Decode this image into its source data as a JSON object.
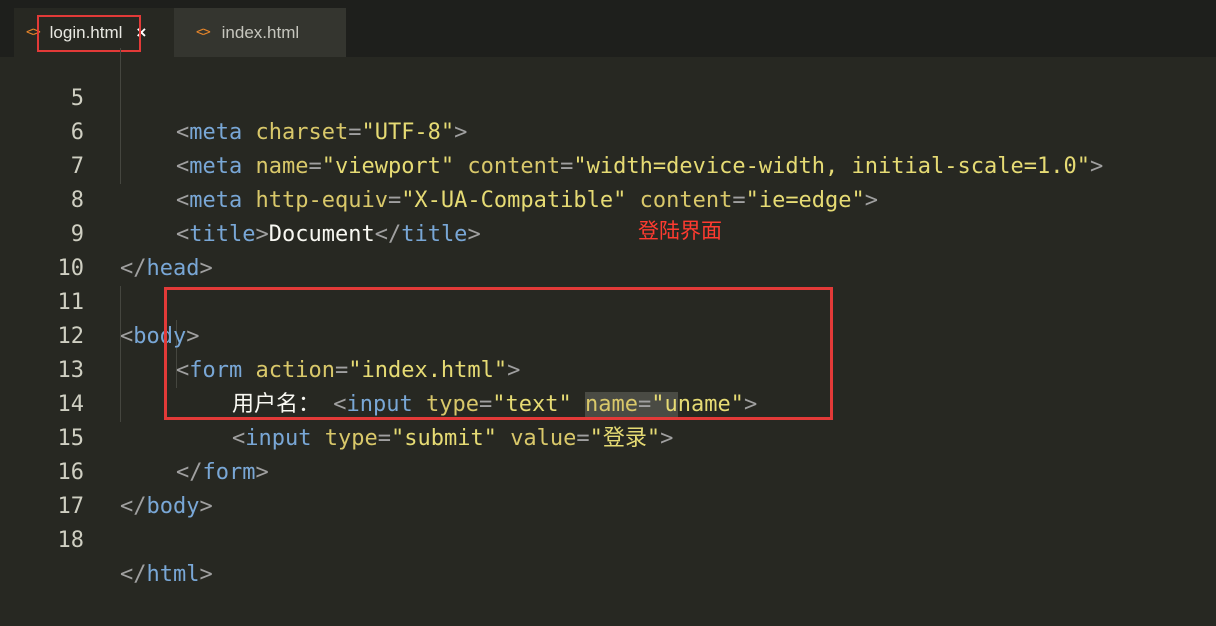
{
  "tabs": [
    {
      "label": "login.html",
      "icon": "html-file-icon",
      "close": "×",
      "active": true
    },
    {
      "label": "index.html",
      "icon": "html-file-icon",
      "active": false
    }
  ],
  "tab_icon_glyph": "<>",
  "annotation": "登陆界面",
  "lines": [
    {
      "num": "5"
    },
    {
      "num": "6"
    },
    {
      "num": "7"
    },
    {
      "num": "8"
    },
    {
      "num": "9"
    },
    {
      "num": "10"
    },
    {
      "num": "11"
    },
    {
      "num": "12"
    },
    {
      "num": "13"
    },
    {
      "num": "14"
    },
    {
      "num": "15"
    },
    {
      "num": "16"
    },
    {
      "num": "17"
    },
    {
      "num": "18"
    }
  ],
  "code": {
    "l5": {
      "lt": "<",
      "tag": "meta",
      "attr1": "charset",
      "eq1": "=",
      "val1": "\"UTF-8\"",
      "gt": ">"
    },
    "l6": {
      "lt": "<",
      "tag": "meta",
      "attr1": "name",
      "val1": "\"viewport\"",
      "attr2": "content",
      "val2": "\"width=device-width, initial-scale=1.0\"",
      "gt": ">"
    },
    "l7": {
      "lt": "<",
      "tag": "meta",
      "attr1": "http-equiv",
      "val1": "\"X-UA-Compatible\"",
      "attr2": "content",
      "val2": "\"ie=edge\"",
      "gt": ">"
    },
    "l8": {
      "lt": "<",
      "tag": "title",
      "gt": ">",
      "text": "Document",
      "close": "</",
      "tag2": "title"
    },
    "l9": {
      "close": "</",
      "tag": "head",
      "gt": ">"
    },
    "l11": {
      "lt": "<",
      "tag": "body",
      "gt": ">"
    },
    "l12": {
      "lt": "<",
      "tag": "form",
      "attr1": "action",
      "val1": "\"index.html\"",
      "gt": ">"
    },
    "l13": {
      "text": "用户名：",
      "lt": "<",
      "tag": "input",
      "attr1": "type",
      "val1": "\"text\"",
      "attr2": "name",
      "val2a": "\"u",
      "val2b": "name\"",
      "gt": ">"
    },
    "l14": {
      "lt": "<",
      "tag": "input",
      "attr1": "type",
      "val1": "\"submit\"",
      "attr2": "value",
      "val2": "\"登录\"",
      "gt": ">"
    },
    "l15": {
      "close": "</",
      "tag": "form",
      "gt": ">"
    },
    "l16": {
      "close": "</",
      "tag": "body",
      "gt": ">"
    },
    "l18": {
      "close": "</",
      "tag": "html",
      "gt": ">"
    }
  },
  "eq": "="
}
